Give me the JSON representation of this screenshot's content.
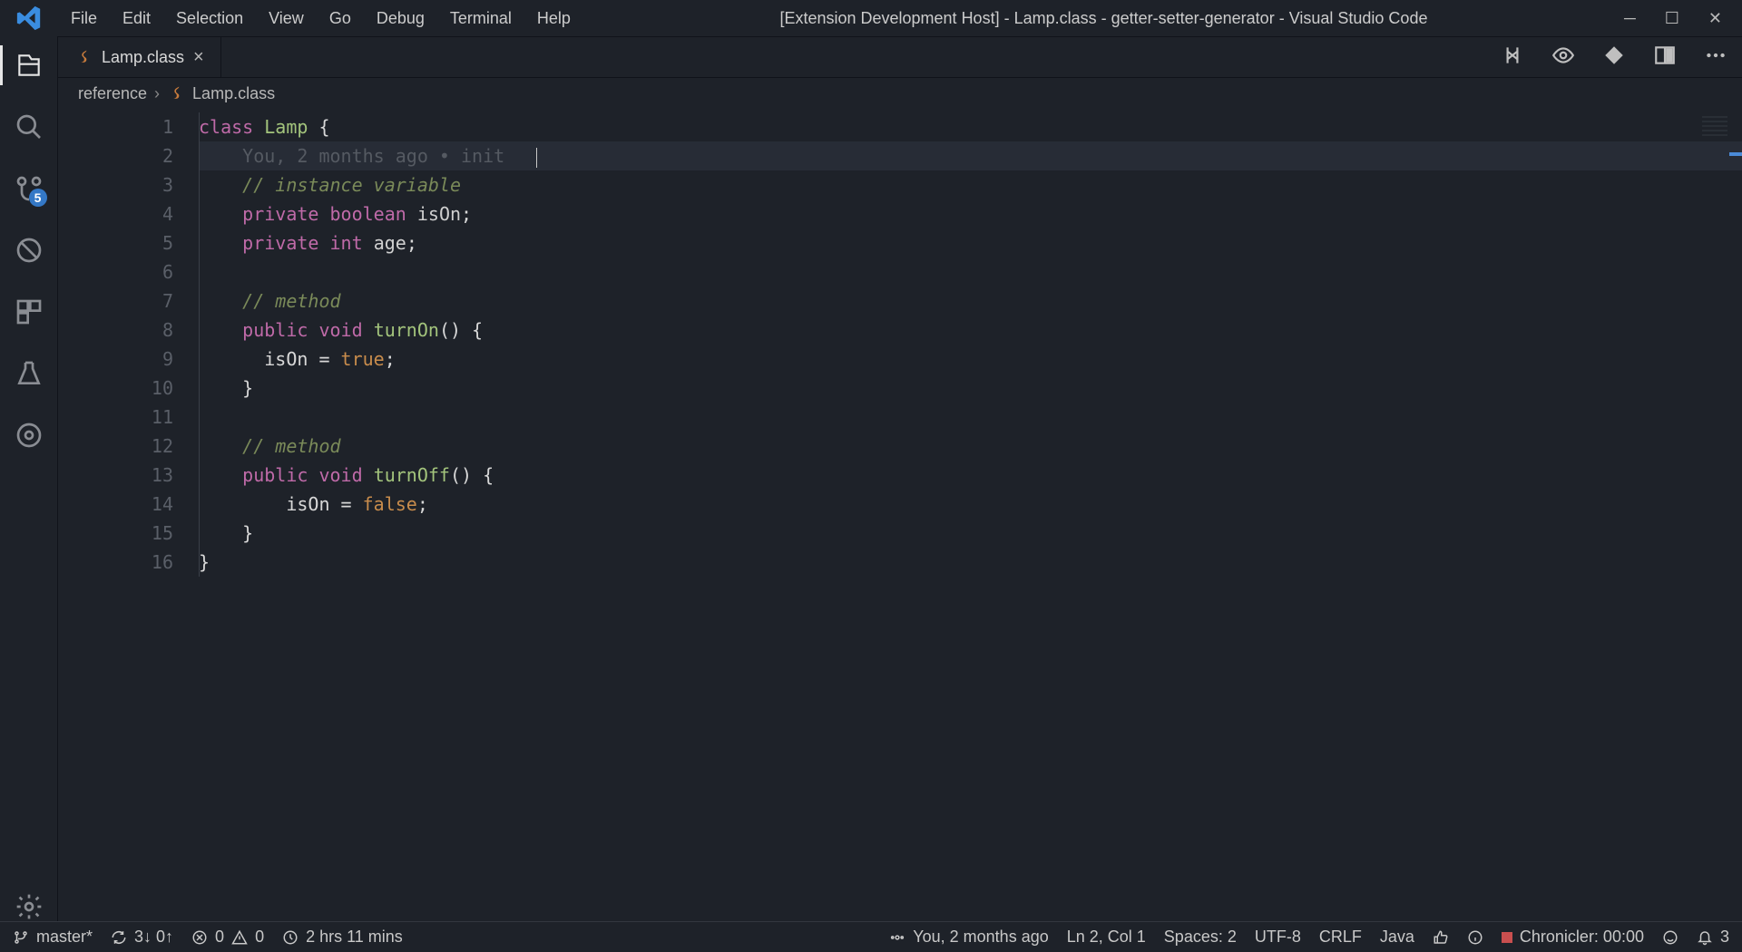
{
  "colors": {
    "accent": "#3478c6",
    "record": "#c94f4f"
  },
  "titlebar": {
    "title": "[Extension Development Host] - Lamp.class - getter-setter-generator - Visual Studio Code",
    "menu": [
      "File",
      "Edit",
      "Selection",
      "View",
      "Go",
      "Debug",
      "Terminal",
      "Help"
    ]
  },
  "activitybar": {
    "items": [
      {
        "name": "explorer",
        "active": true
      },
      {
        "name": "search"
      },
      {
        "name": "scm",
        "badge": "5"
      },
      {
        "name": "debug"
      },
      {
        "name": "extensions"
      },
      {
        "name": "test"
      },
      {
        "name": "lens"
      }
    ]
  },
  "tabs": [
    {
      "label": "Lamp.class",
      "dirty": false,
      "icon": "java"
    }
  ],
  "tabActions": [
    "compare-icon",
    "eye-icon",
    "diff-icon",
    "split-icon",
    "more-icon"
  ],
  "breadcrumbs": [
    {
      "label": "reference"
    },
    {
      "label": "Lamp.class",
      "icon": "java"
    }
  ],
  "editor": {
    "blameHint": "You, 2 months ago • init",
    "cursorCol": 47,
    "lines": [
      [
        {
          "c": "kw",
          "t": "class"
        },
        {
          "c": "punct",
          "t": " "
        },
        {
          "c": "ident",
          "t": "Lamp"
        },
        {
          "c": "punct",
          "t": " {"
        }
      ],
      "BLAME",
      [
        {
          "c": "punct",
          "t": "    "
        },
        {
          "c": "comment",
          "t": "// instance variable"
        }
      ],
      [
        {
          "c": "punct",
          "t": "    "
        },
        {
          "c": "mod",
          "t": "private"
        },
        {
          "c": "punct",
          "t": " "
        },
        {
          "c": "type",
          "t": "boolean"
        },
        {
          "c": "punct",
          "t": " "
        },
        {
          "c": "var",
          "t": "isOn"
        },
        {
          "c": "punct",
          "t": ";"
        }
      ],
      [
        {
          "c": "punct",
          "t": "    "
        },
        {
          "c": "mod",
          "t": "private"
        },
        {
          "c": "punct",
          "t": " "
        },
        {
          "c": "type",
          "t": "int"
        },
        {
          "c": "punct",
          "t": " "
        },
        {
          "c": "var",
          "t": "age"
        },
        {
          "c": "punct",
          "t": ";"
        }
      ],
      [],
      [
        {
          "c": "punct",
          "t": "    "
        },
        {
          "c": "comment",
          "t": "// method"
        }
      ],
      [
        {
          "c": "punct",
          "t": "    "
        },
        {
          "c": "mod",
          "t": "public"
        },
        {
          "c": "punct",
          "t": " "
        },
        {
          "c": "type",
          "t": "void"
        },
        {
          "c": "punct",
          "t": " "
        },
        {
          "c": "ident",
          "t": "turnOn"
        },
        {
          "c": "punct",
          "t": "() {"
        }
      ],
      [
        {
          "c": "punct",
          "t": "      isOn = "
        },
        {
          "c": "lit",
          "t": "true"
        },
        {
          "c": "punct",
          "t": ";"
        }
      ],
      [
        {
          "c": "punct",
          "t": "    }"
        }
      ],
      [],
      [
        {
          "c": "punct",
          "t": "    "
        },
        {
          "c": "comment",
          "t": "// method"
        }
      ],
      [
        {
          "c": "punct",
          "t": "    "
        },
        {
          "c": "mod",
          "t": "public"
        },
        {
          "c": "punct",
          "t": " "
        },
        {
          "c": "type",
          "t": "void"
        },
        {
          "c": "punct",
          "t": " "
        },
        {
          "c": "ident",
          "t": "turnOff"
        },
        {
          "c": "punct",
          "t": "() {"
        }
      ],
      [
        {
          "c": "punct",
          "t": "        isOn = "
        },
        {
          "c": "lit",
          "t": "false"
        },
        {
          "c": "punct",
          "t": ";"
        }
      ],
      [
        {
          "c": "punct",
          "t": "    }"
        }
      ],
      [
        {
          "c": "punct",
          "t": "}"
        }
      ]
    ]
  },
  "status": {
    "branch": "master*",
    "sync": "3↓ 0↑",
    "errors": "0",
    "warnings": "0",
    "time": "2 hrs 11 mins",
    "blame": "You, 2 months ago",
    "cursor": "Ln 2, Col 1",
    "spaces": "Spaces: 2",
    "encoding": "UTF-8",
    "eol": "CRLF",
    "lang": "Java",
    "chronicler": "Chronicler: 00:00",
    "bell": "3"
  }
}
